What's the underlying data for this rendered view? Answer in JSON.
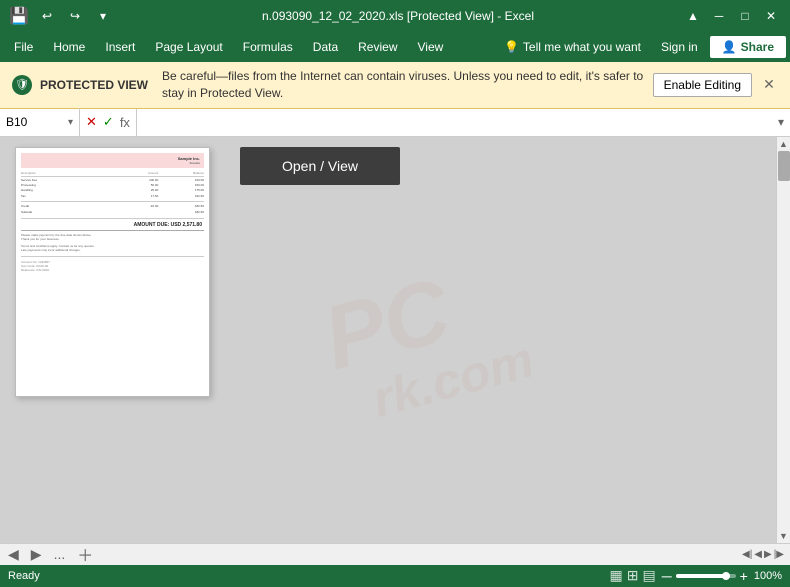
{
  "titleBar": {
    "filename": "n.093090_12_02_2020.xls [Protected View] - Excel",
    "saveIcon": "💾",
    "undoIcon": "↩",
    "redoIcon": "↪",
    "moreIcon": "▾",
    "minimizeIcon": "─",
    "restoreIcon": "□",
    "closeIcon": "✕",
    "ribbonCollapseIcon": "▲"
  },
  "menuBar": {
    "items": [
      "File",
      "Home",
      "Insert",
      "Page Layout",
      "Formulas",
      "Data",
      "Review",
      "View"
    ],
    "tellMe": "Tell me what you want",
    "lightbulbIcon": "💡",
    "signIn": "Sign in",
    "share": "Share",
    "shareIcon": "👤"
  },
  "protectedView": {
    "badge": "PROTECTED VIEW",
    "shieldIcon": "🛡",
    "message": "Be careful—files from the Internet can contain viruses. Unless you need to edit, it's safer to stay in Protected View.",
    "enableBtn": "Enable Editing",
    "closeIcon": "✕"
  },
  "formulaBar": {
    "nameBox": "B10",
    "dropdownIcon": "▾",
    "cancelIcon": "✕",
    "confirmIcon": "✓",
    "fxIcon": "fx",
    "formula": "",
    "expandIcon": "▾"
  },
  "spreadsheet": {
    "openViewBtn": "Open / View",
    "watermark": "PC\nrk.com"
  },
  "sheetTabs": {
    "prevIcon": "◀",
    "nextIcon": "▶",
    "dotsLabel": "...",
    "addIcon": "＋",
    "navIcons": [
      "◀◀",
      "◀",
      "▶",
      "▶▶"
    ]
  },
  "statusBar": {
    "status": "Ready",
    "viewIcons": [
      "▦",
      "⊞",
      "▤"
    ],
    "zoomMinus": "─",
    "zoomPlus": "+",
    "zoomLevel": "100%"
  }
}
